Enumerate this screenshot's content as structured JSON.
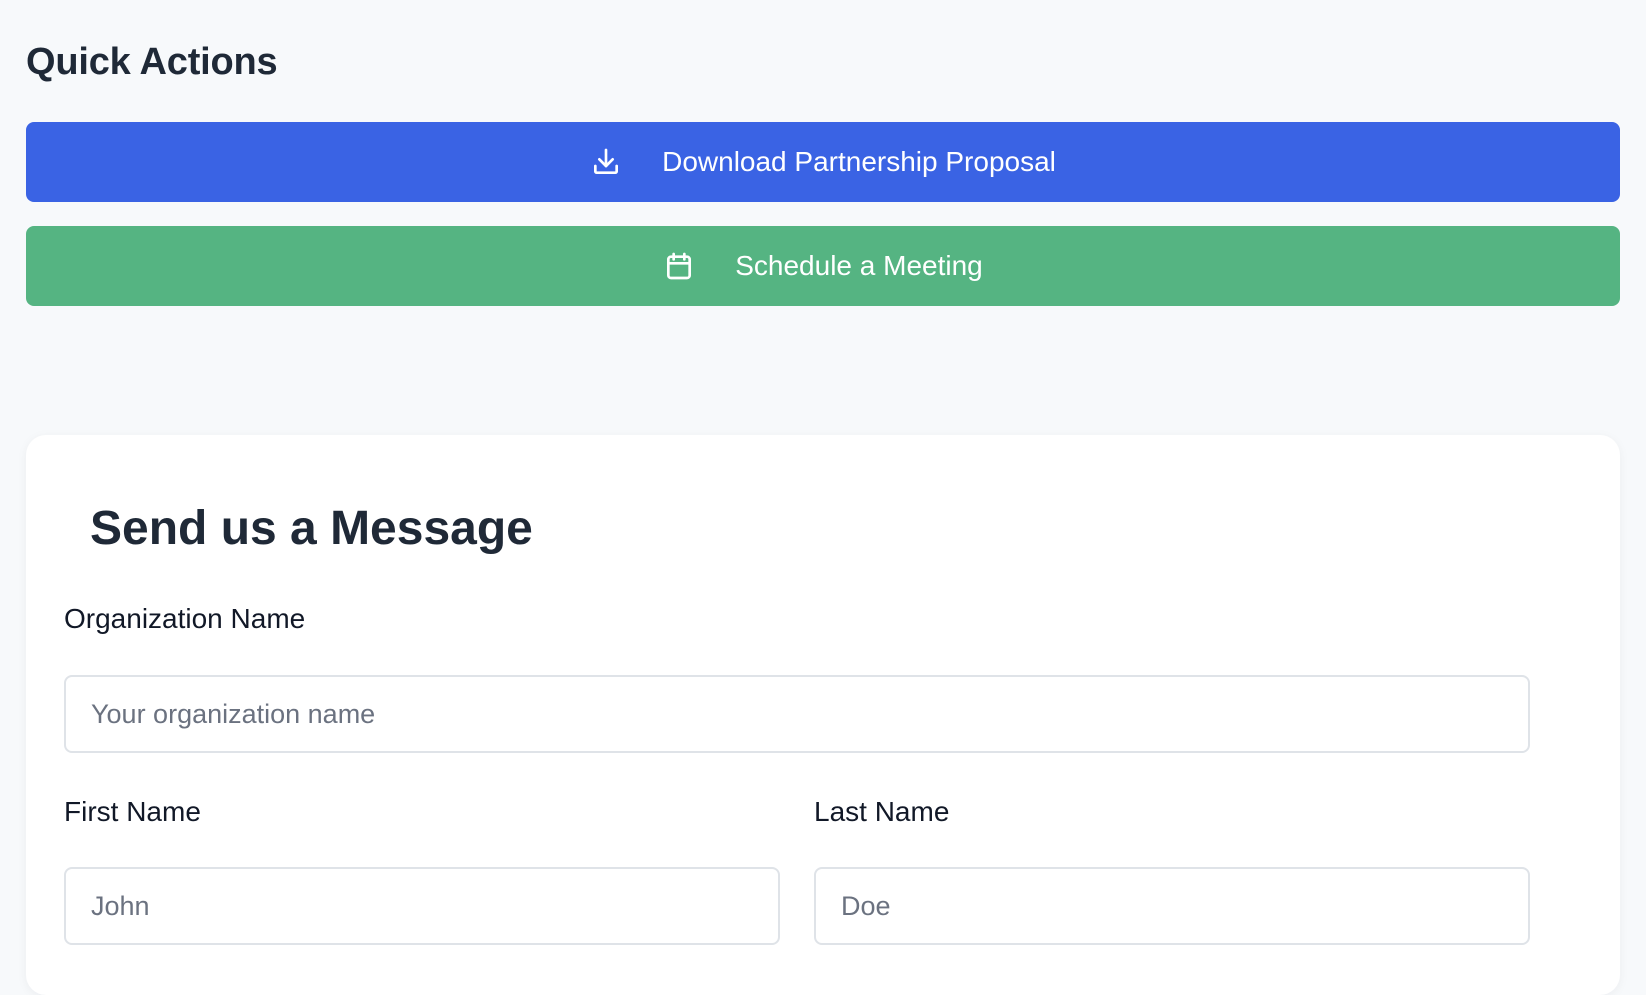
{
  "quick_actions": {
    "title": "Quick Actions",
    "download_label": "Download Partnership Proposal",
    "download_icon": "download-icon",
    "schedule_label": "Schedule a Meeting",
    "schedule_icon": "calendar-icon",
    "colors": {
      "download_bg": "#3a63e4",
      "schedule_bg": "#55b482"
    }
  },
  "message_form": {
    "title": "Send us a Message",
    "organization": {
      "label": "Organization Name",
      "value": "",
      "placeholder": "Your organization name"
    },
    "first_name": {
      "label": "First Name",
      "value": "",
      "placeholder": "John"
    },
    "last_name": {
      "label": "Last Name",
      "value": "",
      "placeholder": "Doe"
    }
  }
}
